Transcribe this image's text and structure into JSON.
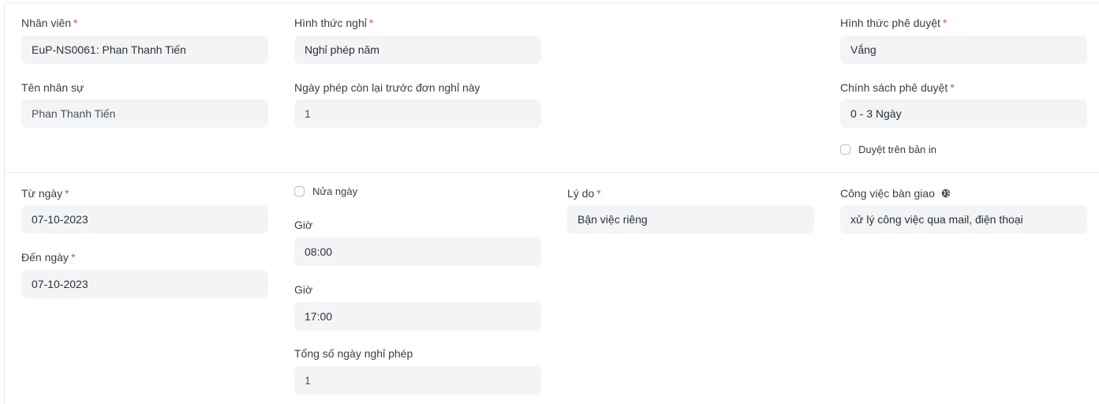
{
  "top": {
    "employee": {
      "label": "Nhân viên",
      "required": "*",
      "value": "EuP-NS0061: Phan Thanh Tiến"
    },
    "leave_type": {
      "label": "Hình thức nghỉ",
      "required": "*",
      "value": "Nghỉ phép năm"
    },
    "approval_form": {
      "label": "Hình thức phê duyệt",
      "required": "*",
      "value": "Vắng"
    },
    "employee_name": {
      "label": "Tên nhân sự",
      "value": "Phan Thanh Tiến"
    },
    "remaining_leave": {
      "label": "Ngày phép còn lại trước đơn nghỉ này",
      "value": "1"
    },
    "approval_policy": {
      "label": "Chính sách phê duyệt",
      "required": "*",
      "value": "0 - 3 Ngày"
    },
    "approve_on_print": {
      "label": "Duyệt trên bản in",
      "checked": false
    }
  },
  "bottom": {
    "from_date": {
      "label": "Từ ngày",
      "required": "*",
      "value": "07-10-2023"
    },
    "to_date": {
      "label": "Đến ngày",
      "required": "*",
      "value": "07-10-2023"
    },
    "half_day": {
      "label": "Nửa ngày",
      "checked": false
    },
    "time_from": {
      "label": "Giờ",
      "value": "08:00"
    },
    "time_to": {
      "label": "Giờ",
      "value": "17:00"
    },
    "total_leave_days": {
      "label": "Tổng số ngày nghỉ phép",
      "value": "1"
    },
    "reason": {
      "label": "Lý do",
      "required": "*",
      "value": "Bận việc riêng"
    },
    "handover": {
      "label": "Công việc bàn giao",
      "icon": "globe-icon",
      "value": "xử lý công việc qua mail, điện thoại"
    }
  }
}
